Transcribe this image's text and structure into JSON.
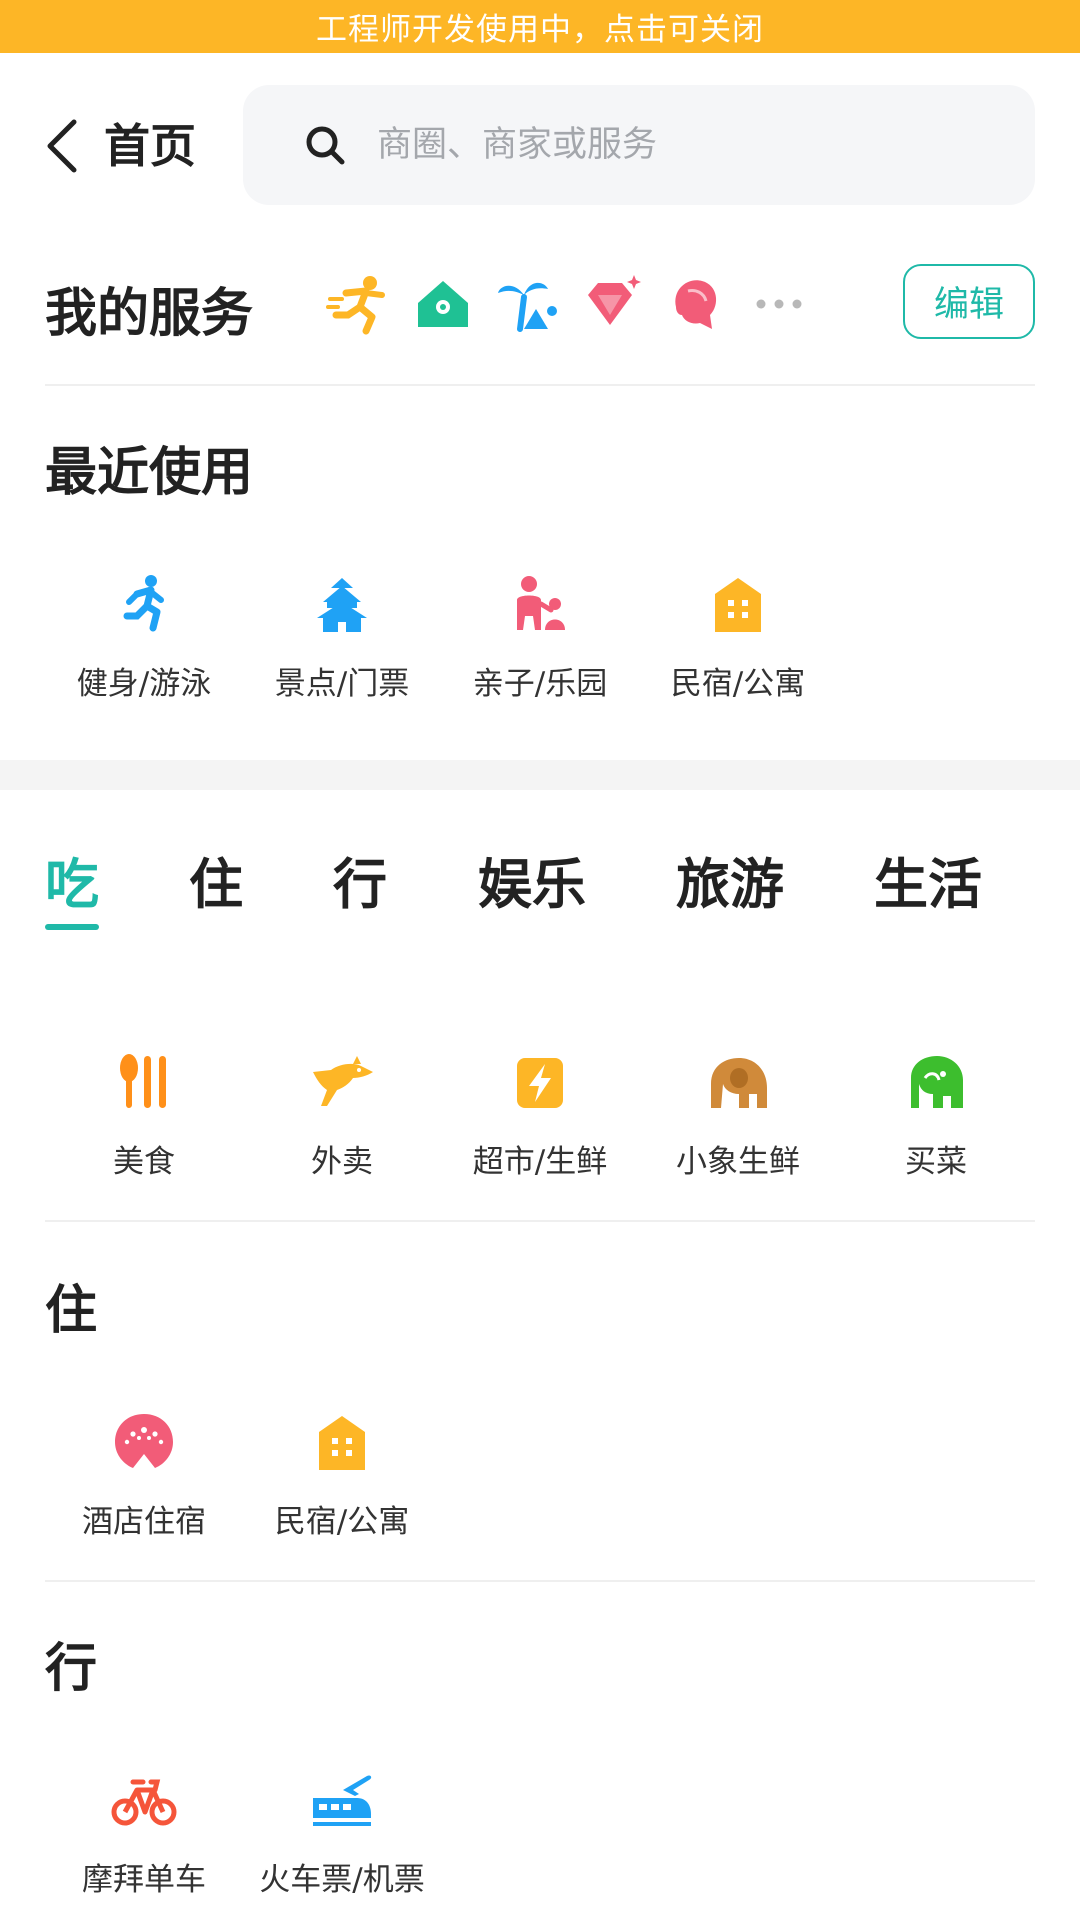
{
  "dev_banner": "工程师开发使用中，点击可关闭",
  "header": {
    "back_label": "首页",
    "search_placeholder": "商圈、商家或服务"
  },
  "my_services": {
    "title": "我的服务",
    "icons": [
      "runner-icon",
      "home-location-icon",
      "beach-palm-icon",
      "diamond-icon",
      "hair-salon-icon",
      "more-dots-icon"
    ],
    "edit_label": "编辑"
  },
  "recent": {
    "title": "最近使用",
    "items": [
      {
        "label": "健身/游泳",
        "icon": "fitness-icon",
        "color": "#1FA2F5"
      },
      {
        "label": "景点/门票",
        "icon": "pagoda-icon",
        "color": "#1FA2F5"
      },
      {
        "label": "亲子/乐园",
        "icon": "parent-child-icon",
        "color": "#F25C78"
      },
      {
        "label": "民宿/公寓",
        "icon": "apartment-icon",
        "color": "#FDB626"
      }
    ]
  },
  "tabs": [
    {
      "label": "吃",
      "active": true
    },
    {
      "label": "住",
      "active": false
    },
    {
      "label": "行",
      "active": false
    },
    {
      "label": "娱乐",
      "active": false
    },
    {
      "label": "旅游",
      "active": false
    },
    {
      "label": "生活",
      "active": false
    }
  ],
  "eat": {
    "items": [
      {
        "label": "美食",
        "icon": "food-utensils-icon",
        "color": "#FF9019"
      },
      {
        "label": "外卖",
        "icon": "kangaroo-icon",
        "color": "#FDB626"
      },
      {
        "label": "超市/生鲜",
        "icon": "lightning-bag-icon",
        "color": "#FDB626"
      },
      {
        "label": "小象生鲜",
        "icon": "elephant-icon",
        "color": "#D08A3A"
      },
      {
        "label": "买菜",
        "icon": "green-elephant-icon",
        "color": "#3DBE2E"
      }
    ]
  },
  "stay": {
    "title": "住",
    "items": [
      {
        "label": "酒店住宿",
        "icon": "hotel-icon",
        "color": "#F25C78"
      },
      {
        "label": "民宿/公寓",
        "icon": "apartment-icon",
        "color": "#FDB626"
      }
    ]
  },
  "travel": {
    "title": "行",
    "items": [
      {
        "label": "摩拜单车",
        "icon": "bicycle-icon",
        "color": "#F5553A"
      },
      {
        "label": "火车票/机票",
        "icon": "train-plane-icon",
        "color": "#1FA2F5"
      }
    ]
  },
  "colors": {
    "accent": "#1FB9A8",
    "banner": "#FDB626"
  }
}
